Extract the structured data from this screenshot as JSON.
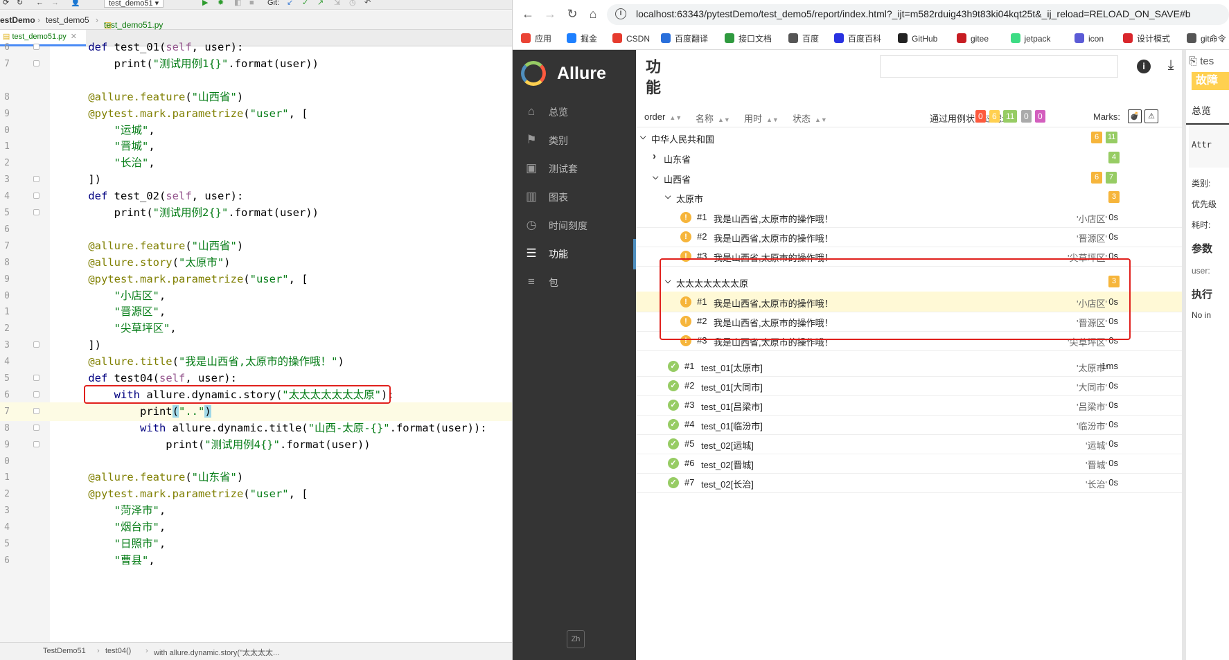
{
  "ide": {
    "toolbar": {
      "run_config": "test_demo51",
      "git_label": "Git:"
    },
    "breadcrumb": [
      "estDemo",
      "test_demo5",
      "test_demo51.py"
    ],
    "tab_label": "test_demo51.py",
    "status": [
      "TestDemo51",
      "test04()",
      "with allure.dynamic.story(\"太太太太..."
    ]
  },
  "code_lines": [
    {
      "ln": "6",
      "text": "    def test_01(self, user):"
    },
    {
      "ln": "7",
      "text": "        print(\"测试用例1{}\".format(user))"
    },
    {
      "ln": "",
      "text": ""
    },
    {
      "ln": "8",
      "text": "    @allure.feature(\"山西省\")"
    },
    {
      "ln": "9",
      "text": "    @pytest.mark.parametrize(\"user\", ["
    },
    {
      "ln": "0",
      "text": "        \"运城\","
    },
    {
      "ln": "1",
      "text": "        \"晋城\","
    },
    {
      "ln": "2",
      "text": "        \"长治\","
    },
    {
      "ln": "3",
      "text": "    ])"
    },
    {
      "ln": "4",
      "text": "    def test_02(self, user):"
    },
    {
      "ln": "5",
      "text": "        print(\"测试用例2{}\".format(user))"
    },
    {
      "ln": "6",
      "text": ""
    },
    {
      "ln": "7",
      "text": "    @allure.feature(\"山西省\")"
    },
    {
      "ln": "8",
      "text": "    @allure.story(\"太原市\")"
    },
    {
      "ln": "9",
      "text": "    @pytest.mark.parametrize(\"user\", ["
    },
    {
      "ln": "0",
      "text": "        \"小店区\","
    },
    {
      "ln": "1",
      "text": "        \"晋源区\","
    },
    {
      "ln": "2",
      "text": "        \"尖草坪区\","
    },
    {
      "ln": "3",
      "text": "    ])"
    },
    {
      "ln": "4",
      "text": "    @allure.title(\"我是山西省,太原市的操作哦！\")"
    },
    {
      "ln": "5",
      "text": "    def test04(self, user):"
    },
    {
      "ln": "6",
      "text": "        with allure.dynamic.story(\"太太太太太太太原\"):"
    },
    {
      "ln": "7",
      "text": "            print(\"..\")"
    },
    {
      "ln": "8",
      "text": "            with allure.dynamic.title(\"山西-太原-{}\".format(user)):"
    },
    {
      "ln": "9",
      "text": "                print(\"测试用例4{}\".format(user))"
    },
    {
      "ln": "0",
      "text": ""
    },
    {
      "ln": "1",
      "text": "    @allure.feature(\"山东省\")"
    },
    {
      "ln": "2",
      "text": "    @pytest.mark.parametrize(\"user\", ["
    },
    {
      "ln": "3",
      "text": "        \"菏泽市\","
    },
    {
      "ln": "4",
      "text": "        \"烟台市\","
    },
    {
      "ln": "5",
      "text": "        \"日照市\","
    },
    {
      "ln": "6",
      "text": "        \"曹县\","
    }
  ],
  "browser": {
    "url": "localhost:63343/pytestDemo/test_demo5/report/index.html?_ijt=m582rduig43h9t83ki04kqt25t&_ij_reload=RELOAD_ON_SAVE#b",
    "bookmarks": [
      {
        "label": "应用",
        "color": "#ea4335"
      },
      {
        "label": "掘金",
        "color": "#1e80ff"
      },
      {
        "label": "CSDN",
        "color": "#e63b2e"
      },
      {
        "label": "百度翻译",
        "color": "#2a6fdb"
      },
      {
        "label": "接口文档",
        "color": "#2f9a3f"
      },
      {
        "label": "百度",
        "color": "#555555"
      },
      {
        "label": "百度百科",
        "color": "#2932e1"
      },
      {
        "label": "GitHub",
        "color": "#222222"
      },
      {
        "label": "gitee",
        "color": "#c71d23"
      },
      {
        "label": "jetpack",
        "color": "#3ddc84"
      },
      {
        "label": "icon",
        "color": "#5b5bd6"
      },
      {
        "label": "设计模式",
        "color": "#d9262c"
      },
      {
        "label": "git命令",
        "color": "#555555"
      }
    ]
  },
  "allure": {
    "brand": "Allure",
    "nav": [
      {
        "label": "总览",
        "icon": "home-icon"
      },
      {
        "label": "类别",
        "icon": "flag-icon"
      },
      {
        "label": "测试套",
        "icon": "briefcase-icon"
      },
      {
        "label": "图表",
        "icon": "bar-chart-icon"
      },
      {
        "label": "时间刻度",
        "icon": "clock-icon"
      },
      {
        "label": "功能",
        "icon": "list-icon",
        "active": true
      },
      {
        "label": "包",
        "icon": "package-icon"
      }
    ],
    "lang": "Zh",
    "page_title": "功能",
    "sort": [
      "order",
      "名称",
      "用时",
      "状态"
    ],
    "filter_label": "通过用例状态过滤:",
    "status_filter": [
      {
        "value": "0",
        "color": "#fd5a3e"
      },
      {
        "value": "6",
        "color": "#ffd050"
      },
      {
        "value": "11",
        "color": "#97cc64"
      },
      {
        "value": "0",
        "color": "#aaaaaa"
      },
      {
        "value": "0",
        "color": "#d35ebe"
      }
    ],
    "marks_label": "Marks:",
    "tree": {
      "root": {
        "name": "中华人民共和国",
        "counts": [
          "6",
          "11"
        ]
      },
      "shandong": {
        "name": "山东省",
        "count": "4"
      },
      "shanxi": {
        "name": "山西省",
        "counts": [
          "6",
          "7"
        ]
      },
      "taiyuan": {
        "name": "太原市",
        "count": "3"
      },
      "taiyuan_cases": [
        {
          "num": "#1",
          "name": "我是山西省,太原市的操作哦！",
          "param": "'小店区'",
          "dur": "0s"
        },
        {
          "num": "#2",
          "name": "我是山西省,太原市的操作哦！",
          "param": "'晋源区'",
          "dur": "0s"
        },
        {
          "num": "#3",
          "name": "我是山西省,太原市的操作哦！",
          "param": "'尖草坪区'",
          "dur": "0s"
        }
      ],
      "tttt": {
        "name": "太太太太太太太原",
        "count": "3"
      },
      "tttt_cases": [
        {
          "num": "#1",
          "name": "我是山西省,太原市的操作哦！",
          "param": "'小店区'",
          "dur": "0s"
        },
        {
          "num": "#2",
          "name": "我是山西省,太原市的操作哦！",
          "param": "'晋源区'",
          "dur": "0s"
        },
        {
          "num": "#3",
          "name": "我是山西省,太原市的操作哦！",
          "param": "'尖草坪区'",
          "dur": "0s"
        }
      ],
      "passed_cases": [
        {
          "num": "#1",
          "name": "test_01[太原市]",
          "param": "'太原市'",
          "dur": "1ms"
        },
        {
          "num": "#2",
          "name": "test_01[大同市]",
          "param": "'大同市'",
          "dur": "0s"
        },
        {
          "num": "#3",
          "name": "test_01[吕梁市]",
          "param": "'吕梁市'",
          "dur": "0s"
        },
        {
          "num": "#4",
          "name": "test_01[临汾市]",
          "param": "'临汾市'",
          "dur": "0s"
        },
        {
          "num": "#5",
          "name": "test_02[运城]",
          "param": "'运城'",
          "dur": "0s"
        },
        {
          "num": "#6",
          "name": "test_02[晋城]",
          "param": "'晋城'",
          "dur": "0s"
        },
        {
          "num": "#7",
          "name": "test_02[长治]",
          "param": "'长治'",
          "dur": "0s"
        }
      ]
    },
    "right_panel": {
      "tab": "tes",
      "badge": "故障",
      "overview": "总览",
      "attr": "Attr",
      "category": "类别:",
      "priority": "优先级",
      "duration": "耗时:",
      "params": "参数",
      "param_user": "user:",
      "exec": "执行",
      "no_info": "No in"
    }
  }
}
